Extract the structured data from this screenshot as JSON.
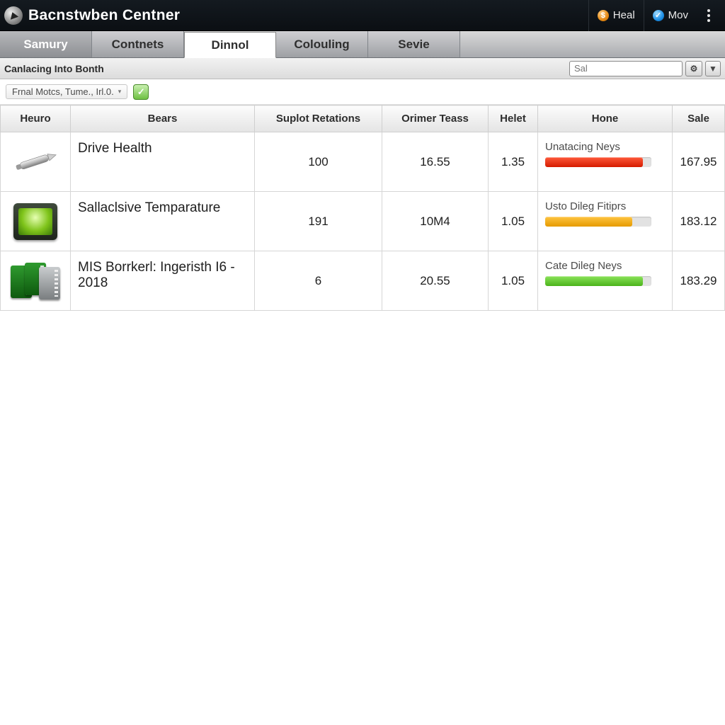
{
  "titlebar": {
    "app_title": "Bacnstwben Centner",
    "heal_label": "Heal",
    "mov_label": "Mov"
  },
  "tabs": [
    {
      "label": "Samury",
      "active": false,
      "first": true
    },
    {
      "label": "Contnets",
      "active": false
    },
    {
      "label": "Dinnol",
      "active": true
    },
    {
      "label": "Colouling",
      "active": false
    },
    {
      "label": "Sevie",
      "active": false
    }
  ],
  "subhead": {
    "breadcrumb": "Canlacing Into Bonth",
    "search_placeholder": "Sal"
  },
  "pathrow": {
    "pill_text": "Frnal Motcs, Tume., Irl.0."
  },
  "columns": {
    "heuro": "Heuro",
    "bears": "Bears",
    "suplot": "Suplot Retations",
    "orimer": "Orimer Teass",
    "helet": "Helet",
    "hone": "Hone",
    "sale": "Sale"
  },
  "rows": [
    {
      "icon": "pen",
      "name": "Drive Health",
      "suplot": "100",
      "orimer": "16.55",
      "helet": "1.35",
      "hone_label": "Unatacing Neys",
      "hone_color": "red",
      "hone_pct": 92,
      "sale": "167.95"
    },
    {
      "icon": "tablet",
      "name": "Sallaclsive Temparature",
      "suplot": "191",
      "orimer": "10M4",
      "helet": "1.05",
      "hone_label": "Usto Dileg Fitiprs",
      "hone_color": "orange",
      "hone_pct": 82,
      "sale": "183.12"
    },
    {
      "icon": "servers",
      "name": "MIS Borrkerl: Ingeristh I6 - 2018",
      "suplot": "6",
      "orimer": "20.55",
      "helet": "1.05",
      "hone_label": "Cate Dileg Neys",
      "hone_color": "green",
      "hone_pct": 92,
      "sale": "183.29"
    }
  ]
}
